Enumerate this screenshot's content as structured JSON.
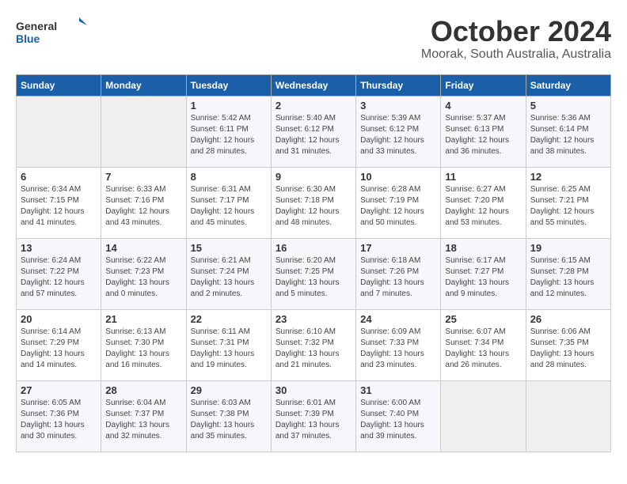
{
  "logo": {
    "line1": "General",
    "line2": "Blue"
  },
  "title": "October 2024",
  "subtitle": "Moorak, South Australia, Australia",
  "days_header": [
    "Sunday",
    "Monday",
    "Tuesday",
    "Wednesday",
    "Thursday",
    "Friday",
    "Saturday"
  ],
  "weeks": [
    [
      {
        "day": "",
        "content": ""
      },
      {
        "day": "",
        "content": ""
      },
      {
        "day": "1",
        "content": "Sunrise: 5:42 AM\nSunset: 6:11 PM\nDaylight: 12 hours\nand 28 minutes."
      },
      {
        "day": "2",
        "content": "Sunrise: 5:40 AM\nSunset: 6:12 PM\nDaylight: 12 hours\nand 31 minutes."
      },
      {
        "day": "3",
        "content": "Sunrise: 5:39 AM\nSunset: 6:12 PM\nDaylight: 12 hours\nand 33 minutes."
      },
      {
        "day": "4",
        "content": "Sunrise: 5:37 AM\nSunset: 6:13 PM\nDaylight: 12 hours\nand 36 minutes."
      },
      {
        "day": "5",
        "content": "Sunrise: 5:36 AM\nSunset: 6:14 PM\nDaylight: 12 hours\nand 38 minutes."
      }
    ],
    [
      {
        "day": "6",
        "content": "Sunrise: 6:34 AM\nSunset: 7:15 PM\nDaylight: 12 hours\nand 41 minutes."
      },
      {
        "day": "7",
        "content": "Sunrise: 6:33 AM\nSunset: 7:16 PM\nDaylight: 12 hours\nand 43 minutes."
      },
      {
        "day": "8",
        "content": "Sunrise: 6:31 AM\nSunset: 7:17 PM\nDaylight: 12 hours\nand 45 minutes."
      },
      {
        "day": "9",
        "content": "Sunrise: 6:30 AM\nSunset: 7:18 PM\nDaylight: 12 hours\nand 48 minutes."
      },
      {
        "day": "10",
        "content": "Sunrise: 6:28 AM\nSunset: 7:19 PM\nDaylight: 12 hours\nand 50 minutes."
      },
      {
        "day": "11",
        "content": "Sunrise: 6:27 AM\nSunset: 7:20 PM\nDaylight: 12 hours\nand 53 minutes."
      },
      {
        "day": "12",
        "content": "Sunrise: 6:25 AM\nSunset: 7:21 PM\nDaylight: 12 hours\nand 55 minutes."
      }
    ],
    [
      {
        "day": "13",
        "content": "Sunrise: 6:24 AM\nSunset: 7:22 PM\nDaylight: 12 hours\nand 57 minutes."
      },
      {
        "day": "14",
        "content": "Sunrise: 6:22 AM\nSunset: 7:23 PM\nDaylight: 13 hours\nand 0 minutes."
      },
      {
        "day": "15",
        "content": "Sunrise: 6:21 AM\nSunset: 7:24 PM\nDaylight: 13 hours\nand 2 minutes."
      },
      {
        "day": "16",
        "content": "Sunrise: 6:20 AM\nSunset: 7:25 PM\nDaylight: 13 hours\nand 5 minutes."
      },
      {
        "day": "17",
        "content": "Sunrise: 6:18 AM\nSunset: 7:26 PM\nDaylight: 13 hours\nand 7 minutes."
      },
      {
        "day": "18",
        "content": "Sunrise: 6:17 AM\nSunset: 7:27 PM\nDaylight: 13 hours\nand 9 minutes."
      },
      {
        "day": "19",
        "content": "Sunrise: 6:15 AM\nSunset: 7:28 PM\nDaylight: 13 hours\nand 12 minutes."
      }
    ],
    [
      {
        "day": "20",
        "content": "Sunrise: 6:14 AM\nSunset: 7:29 PM\nDaylight: 13 hours\nand 14 minutes."
      },
      {
        "day": "21",
        "content": "Sunrise: 6:13 AM\nSunset: 7:30 PM\nDaylight: 13 hours\nand 16 minutes."
      },
      {
        "day": "22",
        "content": "Sunrise: 6:11 AM\nSunset: 7:31 PM\nDaylight: 13 hours\nand 19 minutes."
      },
      {
        "day": "23",
        "content": "Sunrise: 6:10 AM\nSunset: 7:32 PM\nDaylight: 13 hours\nand 21 minutes."
      },
      {
        "day": "24",
        "content": "Sunrise: 6:09 AM\nSunset: 7:33 PM\nDaylight: 13 hours\nand 23 minutes."
      },
      {
        "day": "25",
        "content": "Sunrise: 6:07 AM\nSunset: 7:34 PM\nDaylight: 13 hours\nand 26 minutes."
      },
      {
        "day": "26",
        "content": "Sunrise: 6:06 AM\nSunset: 7:35 PM\nDaylight: 13 hours\nand 28 minutes."
      }
    ],
    [
      {
        "day": "27",
        "content": "Sunrise: 6:05 AM\nSunset: 7:36 PM\nDaylight: 13 hours\nand 30 minutes."
      },
      {
        "day": "28",
        "content": "Sunrise: 6:04 AM\nSunset: 7:37 PM\nDaylight: 13 hours\nand 32 minutes."
      },
      {
        "day": "29",
        "content": "Sunrise: 6:03 AM\nSunset: 7:38 PM\nDaylight: 13 hours\nand 35 minutes."
      },
      {
        "day": "30",
        "content": "Sunrise: 6:01 AM\nSunset: 7:39 PM\nDaylight: 13 hours\nand 37 minutes."
      },
      {
        "day": "31",
        "content": "Sunrise: 6:00 AM\nSunset: 7:40 PM\nDaylight: 13 hours\nand 39 minutes."
      },
      {
        "day": "",
        "content": ""
      },
      {
        "day": "",
        "content": ""
      }
    ]
  ]
}
